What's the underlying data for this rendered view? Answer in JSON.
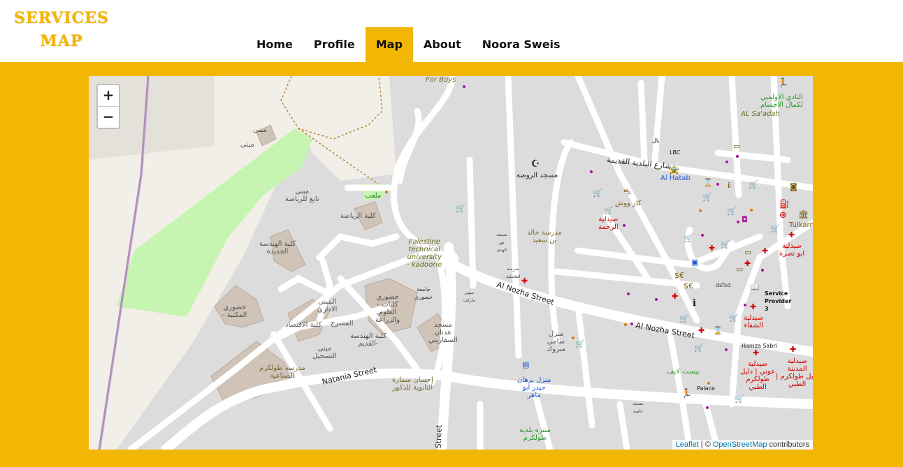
{
  "logo": {
    "line1": "SERVICES",
    "line2": "MAP"
  },
  "nav": {
    "items": [
      {
        "label": "Home"
      },
      {
        "label": "Profile"
      },
      {
        "label": "Map"
      },
      {
        "label": "About"
      },
      {
        "label": "Noora Sweis"
      }
    ],
    "active": "Map"
  },
  "map": {
    "zoom_in": "+",
    "zoom_out": "−",
    "attribution": {
      "leaflet": "Leaflet",
      "separator": " | © ",
      "osm": "OpenStreetMap",
      "suffix": " contributors"
    },
    "streets": {
      "nozha1": "Al Nozha Street",
      "nozha2": "Al Nozha Street",
      "natania": "Natania Street",
      "old_municipality": "شارع البلدية القديمة",
      "street_bottom": "Street"
    },
    "labels": {
      "for_boys": "For Boys",
      "mabna1": "مبنى",
      "mabna2": "مبنى",
      "mabna_sports": "مبنى\nتابع للرياضة",
      "sports_college": "كلية الرياضة",
      "mal3ab": "ملعب",
      "eng_new": "كلية الهندسة\nالجديدة",
      "khadouri_library": "خضوري\n- المكتبة",
      "admin_building": "المبنى\nالاداري",
      "economics": "كلية الاقتصاد",
      "theatre": "المسرح",
      "old_eng": "كلية الهندسة\nالقديم-",
      "registration": "مبنى\nالتسجيل",
      "khadouri_sci": "خضوري\n- كليات\nالعلوم\nوالزراعة",
      "ptu": "Palestine\ntechnical\nuniversity\n- kadoorie",
      "jamia": "جامعة\nخضوري",
      "adnan_mosque": "مسجد\nعدنان\nالسفاريني",
      "tulkarm_industrial": "مدرسة طولكرم\nالصناعية",
      "ihsan_samara": "إحسان سمارة\nالثانوية للذكور",
      "burhan_house": "منزل برهان\nحيدر ابو\nماهر",
      "sami_house": "منزل\nسامي\nمبروك",
      "municipal_park": "منتزه بلدية\nطولكرم",
      "khaled_school": "مدرسة خالد\nبن سعيد",
      "rawda_mosque": "مسجد الروضة",
      "car_wash": "كار ووش",
      "rahma_pharmacy": "صيدلية\nالرحمة",
      "al_hatab": "Al Hatab",
      "olympic_club": "النادي الاولمبي\nلكمال الاجسام",
      "al_saadah": "AL Sa'adah",
      "tulkarm": "Tulkarm",
      "abu_nasra": "صيدلية\nابو نصرة",
      "shifa": "صيدلية\nالشفاء",
      "service_provider": "Service\nProvider\n3",
      "dsfsd": "dsfsd",
      "hamza_sabri": "Hamza  Sabri",
      "aouni": "صيدلية\nعوني | دليل\nطولكرم\nالطبي",
      "madina": "صيدلية\nالمدينة\n| دليل طولكرم\nالطبي",
      "best_life": "بيست لايف",
      "palace": "Palace",
      "lbc": "LBC",
      "bab": "بال",
      "masjid_nour": "مسجد\nنور\nالهدى",
      "madrasa_fadiliya": "مدرسة\nالفاضلية",
      "super_market": "سوبر\nماركت",
      "masjid_small": "مسجد\nخاصة"
    }
  },
  "colors": {
    "accent": "#f2b705",
    "park": "#c5f5b0",
    "road": "#ffffff",
    "landuse": "#dddddd",
    "pharmacy": "#d40000",
    "shop": "#a9159a"
  }
}
